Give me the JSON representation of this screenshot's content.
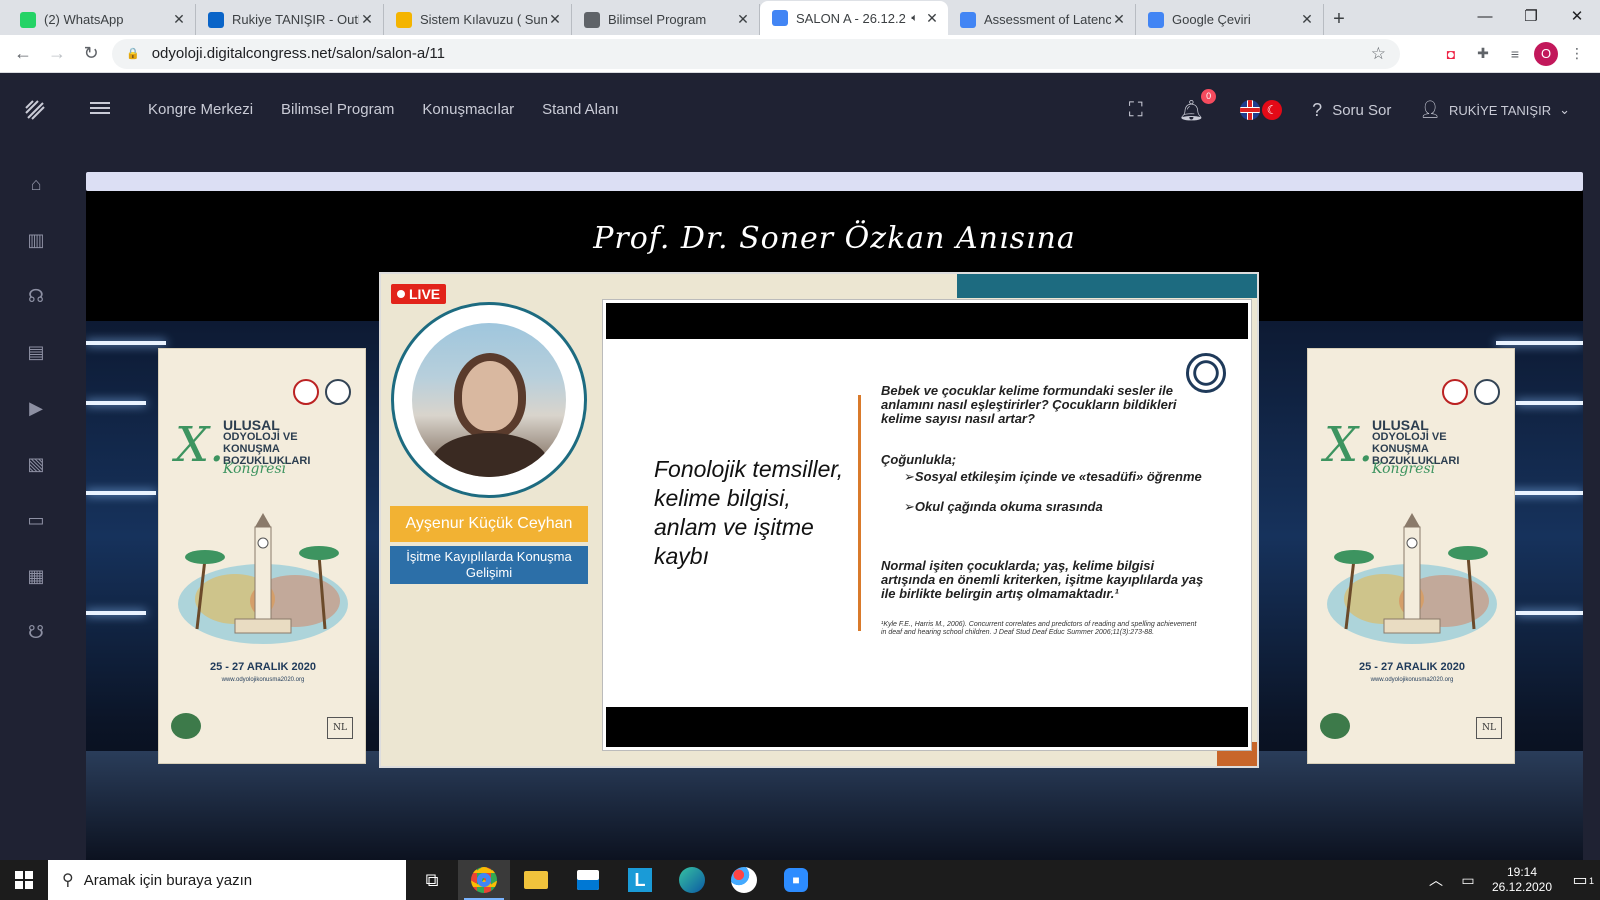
{
  "browser": {
    "tabs": [
      {
        "title": "(2) WhatsApp",
        "favicon_color": "#25d366",
        "active": false
      },
      {
        "title": "Rukiye TANIŞIR - Outlo",
        "favicon_color": "#0a64c8",
        "active": false
      },
      {
        "title": "Sistem Kılavuzu ( Sunu",
        "favicon_color": "#f4b400",
        "active": false
      },
      {
        "title": "Bilimsel Program",
        "favicon_color": "#5f6368",
        "active": false
      },
      {
        "title": "SALON A - 26.12.2",
        "favicon_color": "#4285f4",
        "active": true
      },
      {
        "title": "Assessment of Latency",
        "favicon_color": "#4285f4",
        "active": false
      },
      {
        "title": "Google Çeviri",
        "favicon_color": "#4285f4",
        "active": false
      }
    ],
    "url": "odyoloji.digitalcongress.net/salon/salon-a/11",
    "profile_initial": "O"
  },
  "app": {
    "nav": [
      "Kongre Merkezi",
      "Bilimsel Program",
      "Konuşmacılar",
      "Stand Alanı"
    ],
    "notification_count": "0",
    "ask_label": "Soru Sor",
    "user_name": "RUKİYE TANIŞIR",
    "sidebar_icons": [
      "home-icon",
      "book-icon",
      "speakers-icon",
      "document-icon",
      "play-icon",
      "pdf-icon",
      "chat-icon",
      "stand-icon",
      "headset-icon"
    ]
  },
  "stage": {
    "title": "Prof. Dr. Soner Özkan Anısına",
    "live_label": "LIVE",
    "speaker_name": "Ayşenur Küçük Ceyhan",
    "speaker_topic": "İşitme Kayıplılarda Konuşma Gelişimi",
    "banner": {
      "numeral": "X.",
      "line1": "ULUSAL",
      "line2": "ODYOLOJİ VE",
      "line3": "KONUŞMA BOZUKLUKLARI",
      "script": "Kongresi",
      "date": "25 - 27 ARALIK 2020",
      "url": "www.odyolojikonusma2020.org",
      "logo_text": "NL"
    },
    "slide": {
      "heading": "Fonolojik temsiller, kelime bilgisi, anlam ve işitme kaybı",
      "question": "Bebek ve çocuklar kelime formundaki sesler ile anlamını nasıl eşleştirirler? Çocukların bildikleri kelime sayısı nasıl artar?",
      "cogunlukla": "Çoğunlukla;",
      "bullet1": "➢Sosyal etkileşim içinde ve «tesadüfi» öğrenme",
      "bullet2": "➢Okul çağında okuma sırasında",
      "normal": "Normal işiten çocuklarda; yaş, kelime bilgisi artışında en önemli kriterken, işitme kayıplılarda yaş ile birlikte belirgin artış olmamaktadır.¹",
      "reference": "¹Kyle F.E., Harris M., 2006). Concurrent correlates and predictors of reading and spelling achievement in deaf and hearing school children. J Deaf Stud Deaf Educ Summer 2006;11(3):273-88."
    }
  },
  "taskbar": {
    "search_placeholder": "Aramak için buraya yazın",
    "time": "19:14",
    "date": "26.12.2020",
    "notification_count": "1"
  }
}
